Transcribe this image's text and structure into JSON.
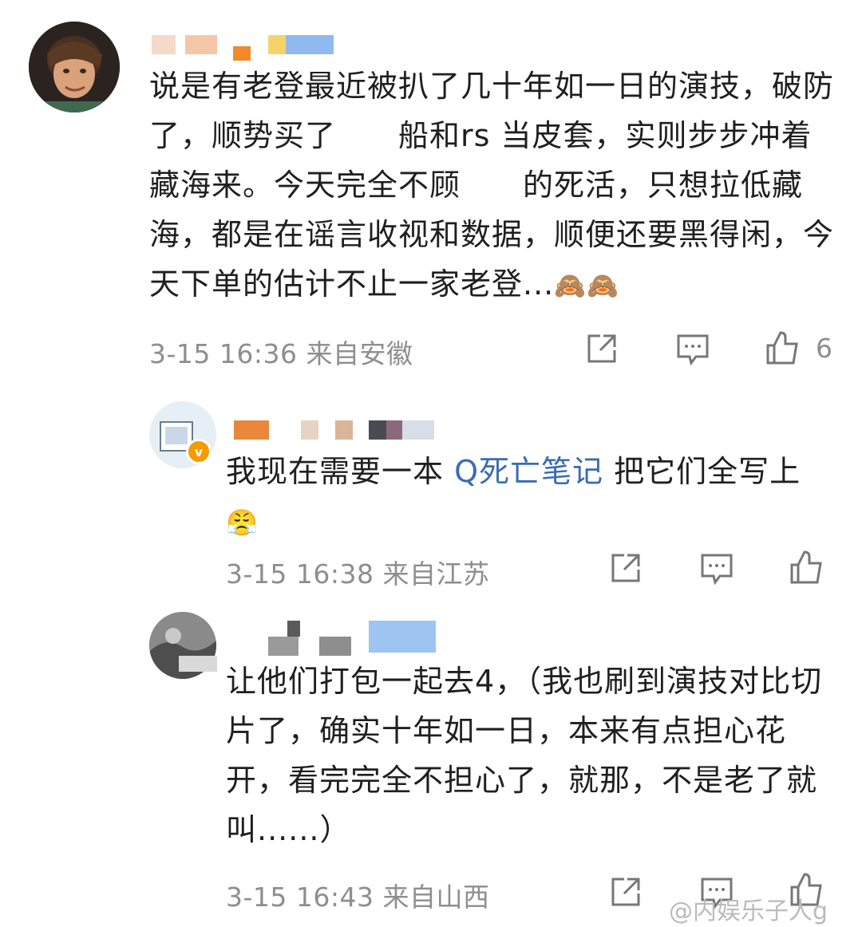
{
  "comments": [
    {
      "text_before_emoji": "说是有老登最近被扒了几十年如一日的演技，破防了，顺势买了  船和rs 当皮套，实则步步冲着藏海来。今天完全不顾  的死活，只想拉低藏海，都是在谣言收视和数据，顺便还要黑得闲，今天下单的估计不止一家老登...",
      "emoji": "🙈🙈",
      "time": "3-15 16:36",
      "location": "来自安徽",
      "likes": "6"
    },
    {
      "text_before_link": "我现在需要一本 ",
      "link_text": "Q死亡笔记",
      "text_after_link": " 把它们全写上",
      "emoji": "😤",
      "time": "3-15 16:38",
      "location": "来自江苏",
      "likes": ""
    },
    {
      "text": "让他们打包一起去4，（我也刷到演技对比切片了，确实十年如一日，本来有点担心花开，看完完全不担心了，就那，不是老了就叫......）",
      "time": "3-15 16:43",
      "location": "来自山西",
      "likes": ""
    }
  ],
  "watermark": "@内娱乐子人g",
  "verified_badge": "v",
  "icons": [
    "share-icon",
    "comment-icon",
    "like-icon"
  ],
  "colors": {
    "link": "#3a6bb5",
    "meta": "#8e8e8e",
    "badge": "#f59a00"
  }
}
